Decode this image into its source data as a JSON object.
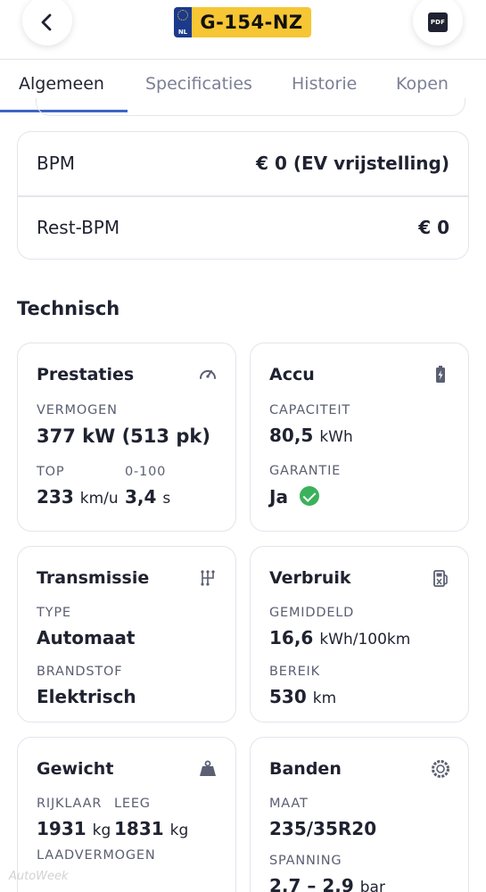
{
  "header": {
    "plate": {
      "country": "NL",
      "number": "G-154-NZ"
    },
    "pdf_label": "PDF",
    "back_icon": "chevron-left-icon",
    "pdf_icon": "pdf-file-icon"
  },
  "tabs": [
    {
      "label": "Algemeen",
      "active": true
    },
    {
      "label": "Specificaties",
      "active": false
    },
    {
      "label": "Historie",
      "active": false
    },
    {
      "label": "Kopen",
      "active": false
    }
  ],
  "bpm": {
    "rows": [
      {
        "label": "BPM",
        "value": "€ 0 (EV vrijstelling)"
      },
      {
        "label": "Rest-BPM",
        "value": "€ 0"
      }
    ]
  },
  "section_title": "Technisch",
  "cards": {
    "prestaties": {
      "title": "Prestaties",
      "icon": "speedometer-icon",
      "vermogen_label": "VERMOGEN",
      "vermogen_value": "377 kW (513 pk)",
      "top_label": "TOP",
      "top_value": "233",
      "top_unit": "km/u",
      "accel_label": "0-100",
      "accel_value": "3,4",
      "accel_unit": "s"
    },
    "accu": {
      "title": "Accu",
      "icon": "battery-charging-icon",
      "capaciteit_label": "CAPACITEIT",
      "capaciteit_value": "80,5",
      "capaciteit_unit": "kWh",
      "garantie_label": "GARANTIE",
      "garantie_value": "Ja"
    },
    "transmissie": {
      "title": "Transmissie",
      "icon": "gear-shift-icon",
      "type_label": "TYPE",
      "type_value": "Automaat",
      "brandstof_label": "BRANDSTOF",
      "brandstof_value": "Elektrisch"
    },
    "verbruik": {
      "title": "Verbruik",
      "icon": "fuel-station-icon",
      "gemiddeld_label": "GEMIDDELD",
      "gemiddeld_value": "16,6",
      "gemiddeld_unit": "kWh/100km",
      "bereik_label": "BEREIK",
      "bereik_value": "530",
      "bereik_unit": "km"
    },
    "gewicht": {
      "title": "Gewicht",
      "icon": "weight-icon",
      "rijklaar_label": "RIJKLAAR",
      "rijklaar_value": "1931",
      "rijklaar_unit": "kg",
      "leeg_label": "LEEG",
      "leeg_value": "1831",
      "leeg_unit": "kg",
      "laadvermogen_label": "LAADVERMOGEN"
    },
    "banden": {
      "title": "Banden",
      "icon": "tire-icon",
      "maat_label": "MAAT",
      "maat_value": "235/35R20",
      "spanning_label": "SPANNING",
      "spanning_value": "2,7 – 2,9",
      "spanning_unit": "bar"
    }
  },
  "watermark": "AutoWeek",
  "colors": {
    "accent": "#3d66c4",
    "plate": "#f6c634",
    "success": "#3cb15c",
    "text": "#1f2230",
    "muted": "#7b8095"
  }
}
